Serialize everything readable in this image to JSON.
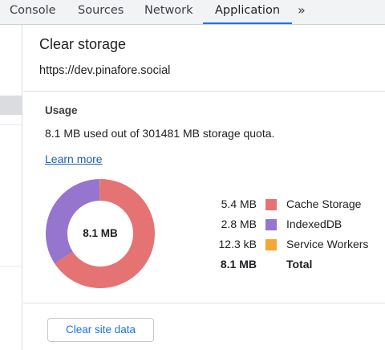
{
  "tabs": [
    {
      "label": "Console"
    },
    {
      "label": "Sources"
    },
    {
      "label": "Network"
    },
    {
      "label": "Application",
      "active": true
    }
  ],
  "more_tabs_glyph": "»",
  "panel": {
    "title": "Clear storage",
    "origin": "https://dev.pinafore.social"
  },
  "usage": {
    "heading": "Usage",
    "quota_text": "8.1 MB used out of 301481 MB storage quota.",
    "learn_more": "Learn more",
    "total_center": "8.1 MB"
  },
  "chart_data": {
    "type": "pie",
    "categories": [
      "Cache Storage",
      "IndexedDB",
      "Service Workers"
    ],
    "values": [
      5.4,
      2.8,
      0.0123
    ],
    "units": "MB",
    "colors": [
      "#e57373",
      "#9575cd",
      "#f4a636"
    ],
    "legend": "right"
  },
  "legend": [
    {
      "size": "5.4 MB",
      "name": "Cache Storage",
      "color": "#e57373"
    },
    {
      "size": "2.8 MB",
      "name": "IndexedDB",
      "color": "#9575cd"
    },
    {
      "size": "12.3 kB",
      "name": "Service Workers",
      "color": "#f4a636"
    }
  ],
  "total": {
    "size": "8.1 MB",
    "name": "Total"
  },
  "clear_button": "Clear site data"
}
